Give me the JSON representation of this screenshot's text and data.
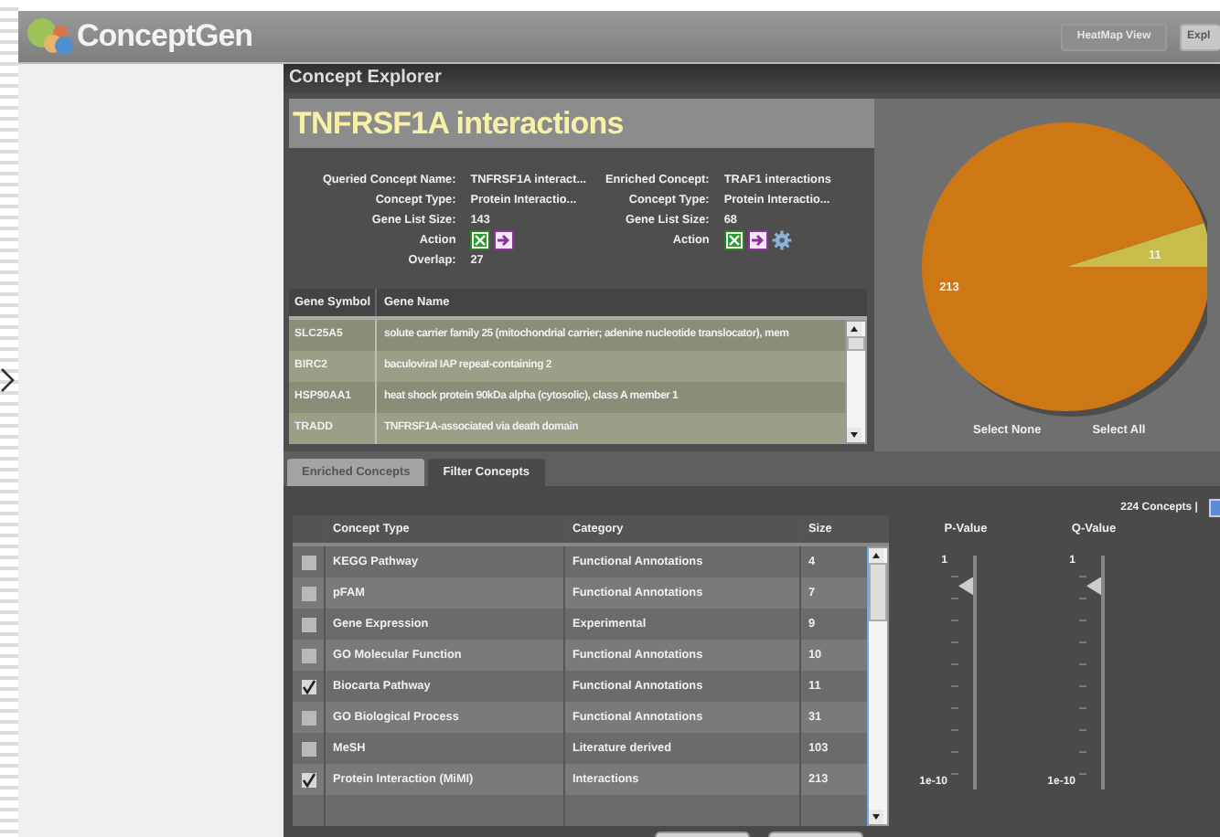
{
  "app": {
    "name": "ConceptGen",
    "header_buttons": [
      {
        "label": "HeatMap View",
        "disabled": true
      },
      {
        "label": "Expl",
        "disabled": false
      }
    ]
  },
  "window": {
    "title": "Concept Explorer"
  },
  "concept_title": "TNFRSF1A interactions",
  "details": [
    {
      "fields": [
        {
          "kind": "text",
          "label": "Queried Concept Name:",
          "value": "TNFRSF1A interact..."
        },
        {
          "kind": "text",
          "label": "Concept Type:",
          "value": "Protein Interactio..."
        },
        {
          "kind": "text",
          "label": "Gene List Size:",
          "value": "143"
        },
        {
          "kind": "actions",
          "label": "Action",
          "settings": false
        },
        {
          "kind": "text",
          "label": "Overlap:",
          "value": "27"
        }
      ]
    },
    {
      "fields": [
        {
          "kind": "text",
          "label": "Enriched Concept:",
          "value": "TRAF1 interactions"
        },
        {
          "kind": "text",
          "label": "Concept Type:",
          "value": "Protein Interactio..."
        },
        {
          "kind": "text",
          "label": "Gene List Size:",
          "value": "68"
        },
        {
          "kind": "actions",
          "label": "Action",
          "settings": true
        }
      ]
    }
  ],
  "gene_table": {
    "columns": [
      "Gene Symbol",
      "Gene Name"
    ],
    "rows": [
      {
        "symbol": "SLC25A5",
        "name": "solute carrier family 25 (mitochondrial carrier; adenine nucleotide translocator), mem"
      },
      {
        "symbol": "BIRC2",
        "name": "baculoviral IAP repeat-containing 2"
      },
      {
        "symbol": "HSP90AA1",
        "name": "heat shock protein 90kDa alpha (cytosolic), class A member 1"
      },
      {
        "symbol": "TRADD",
        "name": "TNFRSF1A-associated via death domain"
      }
    ]
  },
  "overlap_chart": {
    "chart_data": {
      "type": "pie",
      "values": [
        213,
        11
      ],
      "data_labels": true
    },
    "buttons": [
      "Select None",
      "Select All"
    ]
  },
  "tabs": [
    {
      "label": "Enriched Concepts",
      "selected": false
    },
    {
      "label": "Filter Concepts",
      "selected": true
    }
  ],
  "concept_count": "224 Concepts |",
  "concept_table": {
    "columns": [
      "Concept Type",
      "Category",
      "Size"
    ],
    "rows": [
      {
        "checked": false,
        "type": "KEGG Pathway",
        "category": "Functional Annotations",
        "size": "4"
      },
      {
        "checked": false,
        "type": "pFAM",
        "category": "Functional Annotations",
        "size": "7"
      },
      {
        "checked": false,
        "type": "Gene Expression",
        "category": "Experimental",
        "size": "9"
      },
      {
        "checked": false,
        "type": "GO Molecular Function",
        "category": "Functional Annotations",
        "size": "10"
      },
      {
        "checked": true,
        "type": "Biocarta Pathway",
        "category": "Functional Annotations",
        "size": "11"
      },
      {
        "checked": false,
        "type": "GO Biological Process",
        "category": "Functional Annotations",
        "size": "31"
      },
      {
        "checked": false,
        "type": "MeSH",
        "category": "Literature derived",
        "size": "103"
      },
      {
        "checked": true,
        "type": "Protein Interaction (MiMI)",
        "category": "Interactions",
        "size": "213"
      }
    ]
  },
  "sliders": [
    {
      "label": "P-Value",
      "max": "1",
      "min": "1e-10",
      "level": 0.87
    },
    {
      "label": "Q-Value",
      "max": "1",
      "min": "1e-10",
      "level": 0.87
    }
  ]
}
